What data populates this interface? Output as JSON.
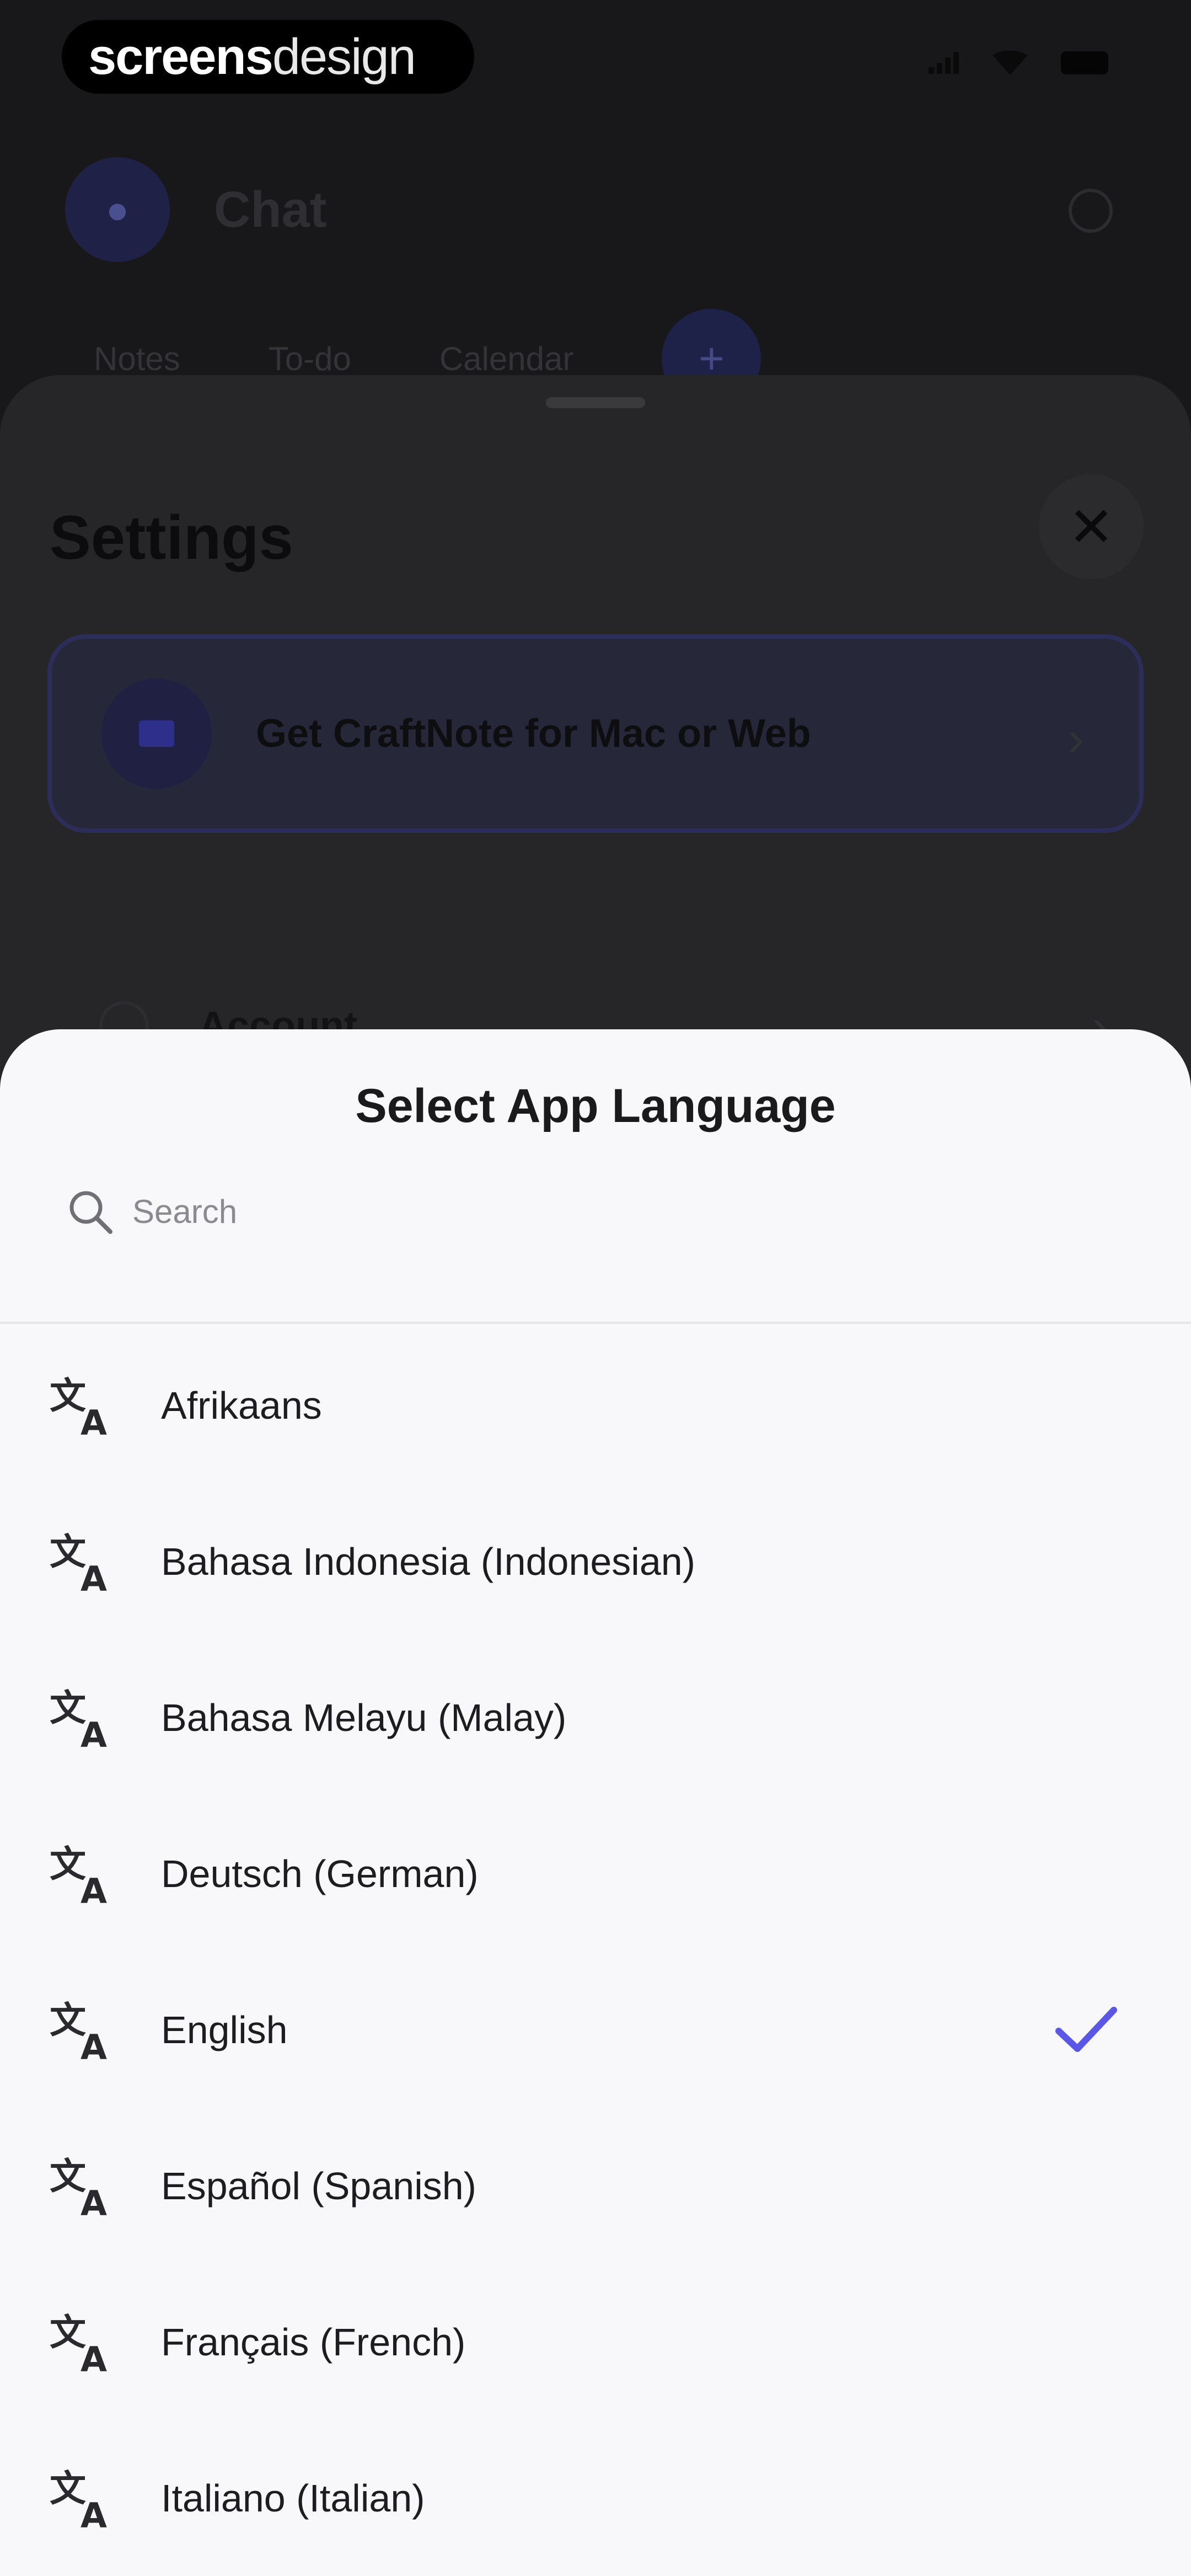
{
  "status_bar": {
    "brand_bold": "screens",
    "brand_light": "design"
  },
  "header": {
    "title": "Chat"
  },
  "tabs": [
    {
      "label": "Notes"
    },
    {
      "label": "To-do"
    },
    {
      "label": "Calendar"
    }
  ],
  "settings": {
    "title": "Settings",
    "promo_text": "Get CraftNote for Mac or Web",
    "account_label": "Account"
  },
  "language_sheet": {
    "title": "Select App Language",
    "search": {
      "placeholder": "Search",
      "value": ""
    },
    "items": [
      {
        "label": "Afrikaans",
        "selected": false
      },
      {
        "label": "Bahasa Indonesia (Indonesian)",
        "selected": false
      },
      {
        "label": "Bahasa Melayu (Malay)",
        "selected": false
      },
      {
        "label": "Deutsch (German)",
        "selected": false
      },
      {
        "label": "English",
        "selected": true
      },
      {
        "label": "Español (Spanish)",
        "selected": false
      },
      {
        "label": "Français (French)",
        "selected": false
      },
      {
        "label": "Italiano (Italian)",
        "selected": false
      }
    ]
  },
  "icons": {
    "language": "translate-icon",
    "check": "checkmark-icon",
    "search": "search-icon"
  },
  "colors": {
    "accent": "#5b57e6",
    "sheet_background": "#f8f8fb",
    "text": "#1d1d21"
  }
}
